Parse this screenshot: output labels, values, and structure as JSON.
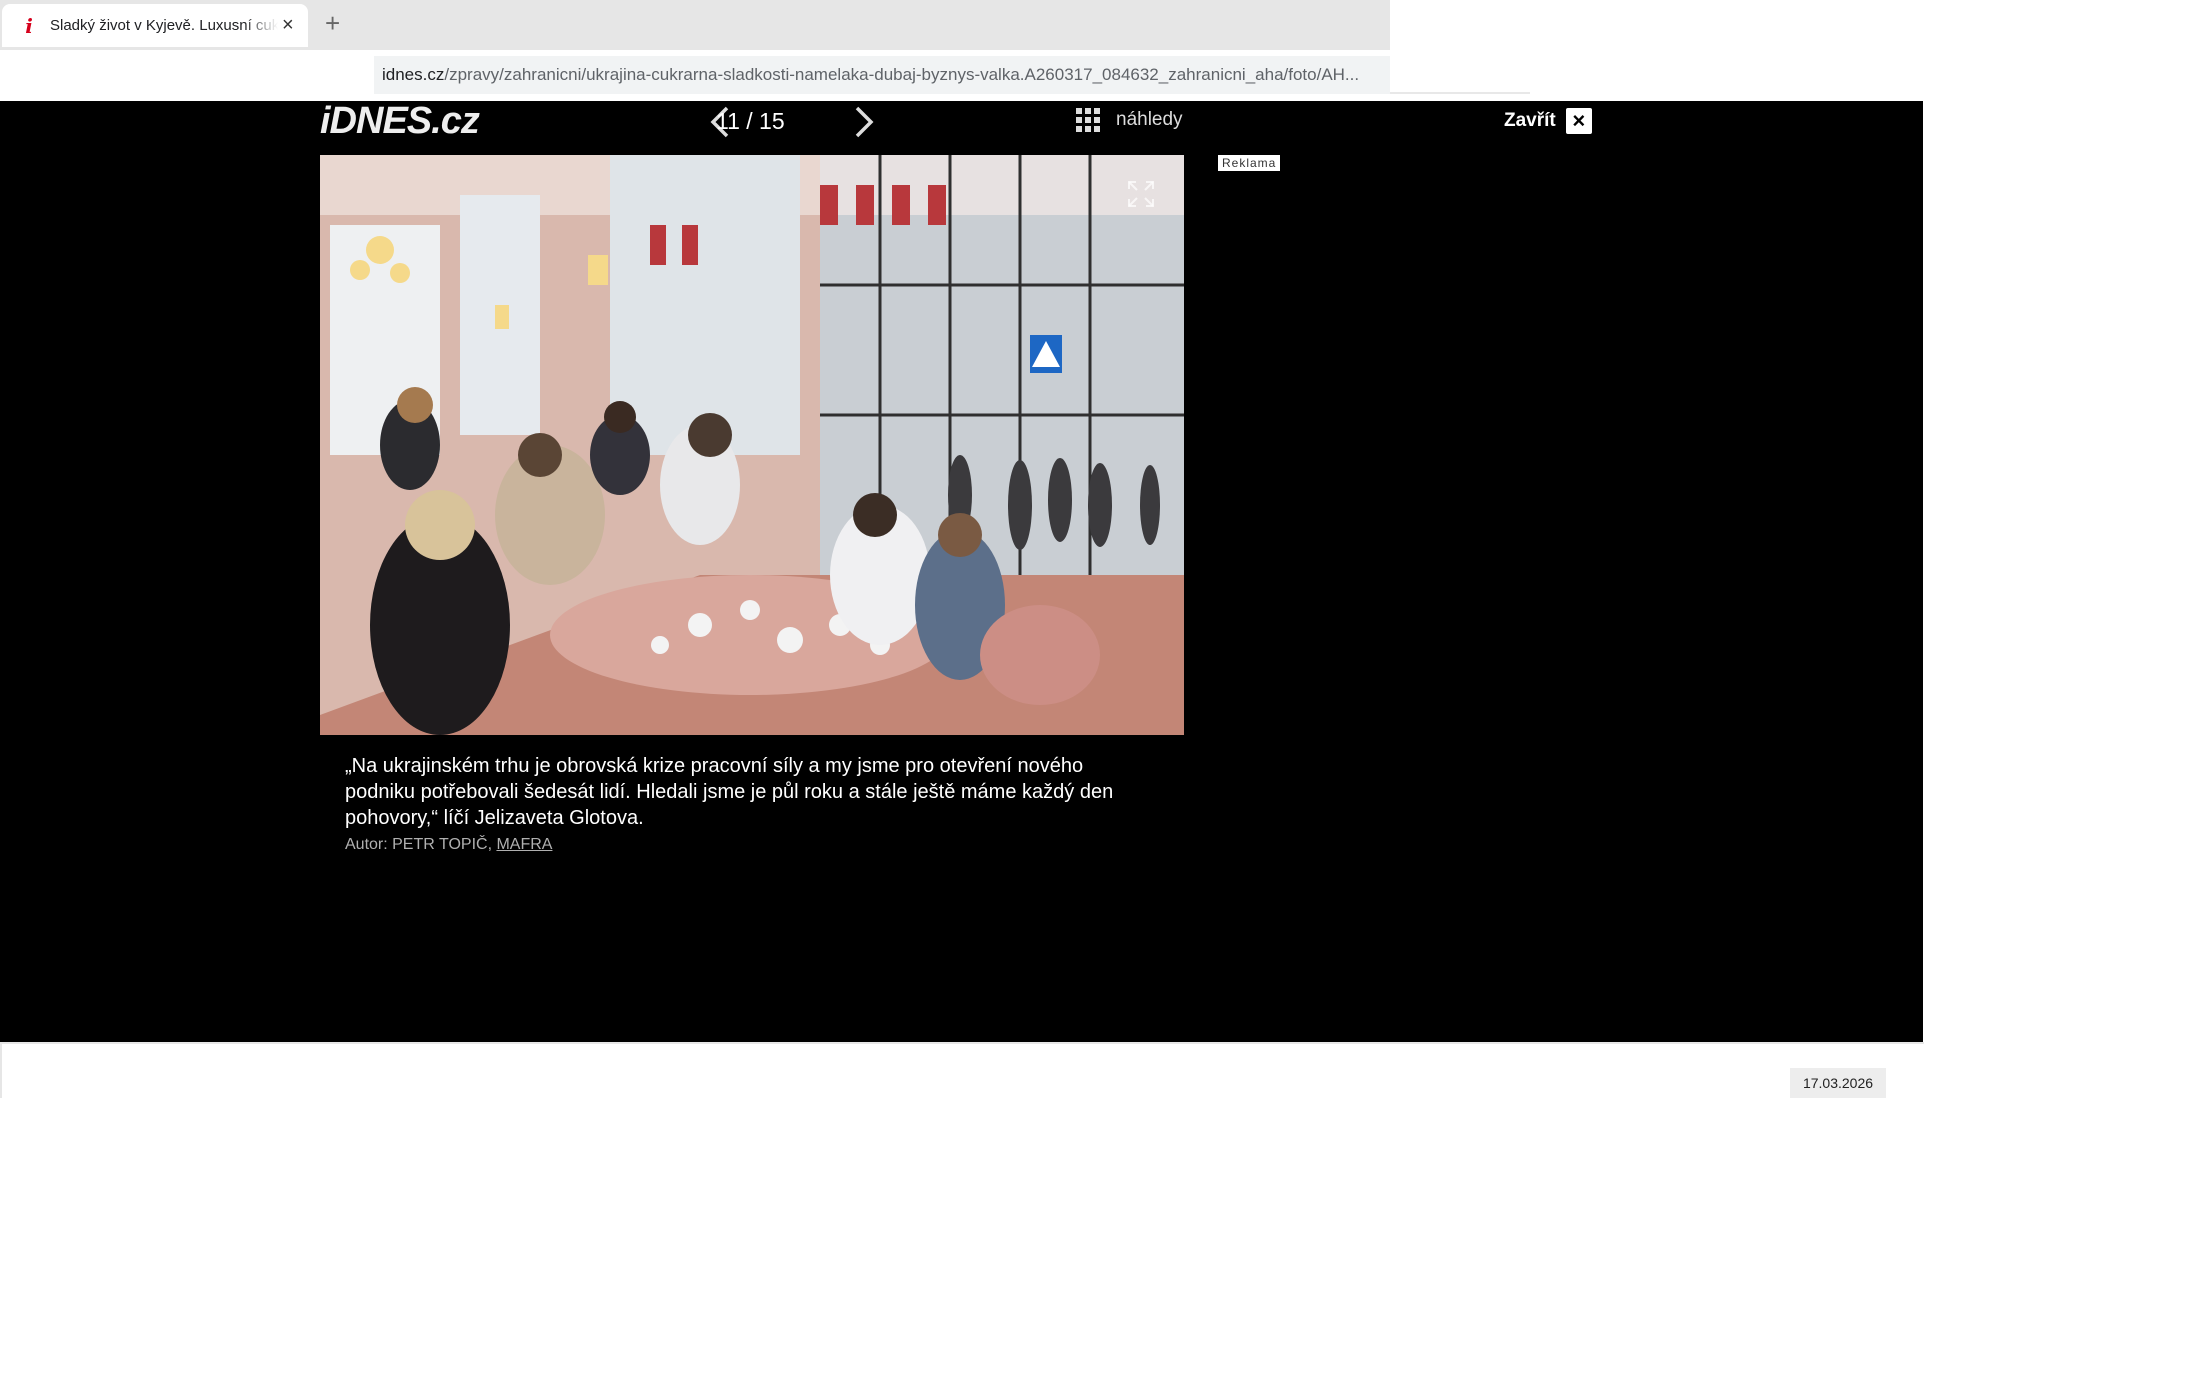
{
  "browser": {
    "tab_title": "Sladký život v Kyjevě. Luxusní cukrárna",
    "favicon": "i",
    "url_host": "idnes.cz",
    "url_path": "/zpravy/zahranicni/ukrajina-cukrarna-sladkosti-namelaka-dubaj-byznys-valka.A260317_084632_zahranicni_aha/foto/AH..."
  },
  "gallery": {
    "logo": "iDNES.cz",
    "counter": "11 / 15",
    "thumbs_label": "náhledy",
    "close_label": "Zavřít",
    "ad_label": "Reklama",
    "caption": "„Na ukrajinském trhu je obrovská krize pracovní síly a my jsme pro otevření nového podniku potřebovali šedesát lidí. Hledali jsme je půl roku a stále ještě máme každý den pohovory,“ líčí Jelizaveta Glotova.",
    "credit_prefix": "Autor: PETR TOPIČ, ",
    "credit_source": "MAFRA"
  },
  "footer": {
    "date": "17.03.2026"
  },
  "icons": [
    "close-icon",
    "plus-icon",
    "chevron-left-icon",
    "chevron-right-icon",
    "grid-icon",
    "expand-icon"
  ]
}
